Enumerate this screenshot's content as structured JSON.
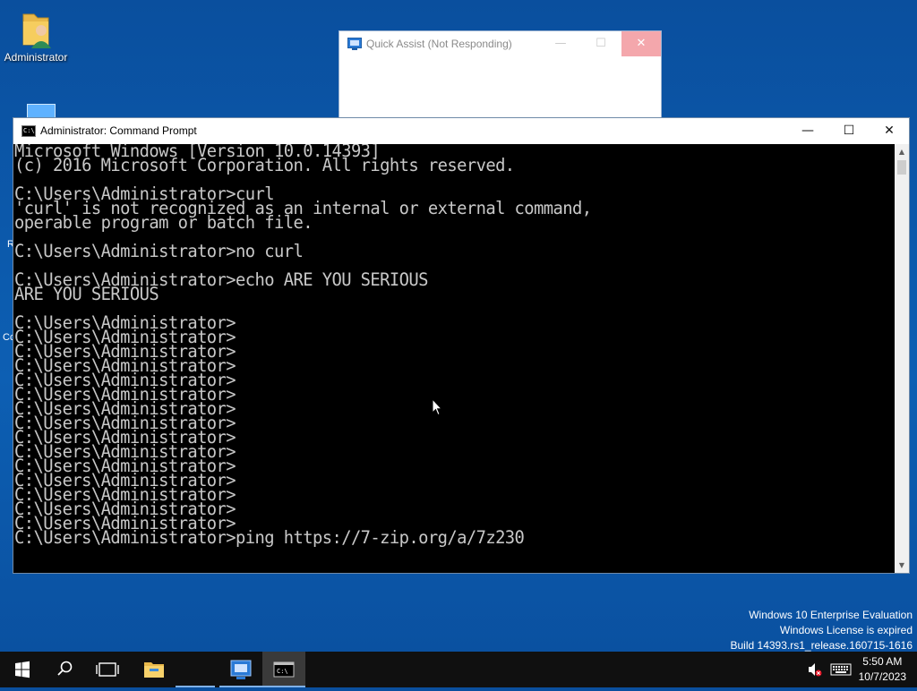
{
  "desktop": {
    "icons": [
      {
        "label": "Administrator"
      }
    ],
    "peek_letters": [
      "R",
      "Cc"
    ]
  },
  "quick_assist": {
    "title": "Quick Assist (Not Responding)",
    "minimize": "—",
    "maximize": "☐",
    "close": "✕"
  },
  "cmd": {
    "title": "Administrator: Command Prompt",
    "icon_text": "C:\\",
    "minimize": "—",
    "maximize": "☐",
    "close": "✕",
    "lines": [
      "Microsoft Windows [Version 10.0.14393]",
      "(c) 2016 Microsoft Corporation. All rights reserved.",
      "",
      "C:\\Users\\Administrator>curl",
      "'curl' is not recognized as an internal or external command,",
      "operable program or batch file.",
      "",
      "C:\\Users\\Administrator>no curl",
      "",
      "C:\\Users\\Administrator>echo ARE YOU SERIOUS",
      "ARE YOU SERIOUS",
      "",
      "C:\\Users\\Administrator>",
      "C:\\Users\\Administrator>",
      "C:\\Users\\Administrator>",
      "C:\\Users\\Administrator>",
      "C:\\Users\\Administrator>",
      "C:\\Users\\Administrator>",
      "C:\\Users\\Administrator>",
      "C:\\Users\\Administrator>",
      "C:\\Users\\Administrator>",
      "C:\\Users\\Administrator>",
      "C:\\Users\\Administrator>",
      "C:\\Users\\Administrator>",
      "C:\\Users\\Administrator>",
      "C:\\Users\\Administrator>",
      "C:\\Users\\Administrator>",
      "C:\\Users\\Administrator>ping https://7-zip.org/a/7z230"
    ]
  },
  "watermark": {
    "line1": "Windows 10 Enterprise Evaluation",
    "line2": "Windows License is expired",
    "line3": "Build 14393.rs1_release.160715-1616"
  },
  "taskbar": {
    "items": [
      {
        "name": "start-button",
        "icon": "windows-logo-icon"
      },
      {
        "name": "search-button",
        "icon": "search-icon"
      },
      {
        "name": "task-view-button",
        "icon": "task-view-icon"
      },
      {
        "name": "file-explorer",
        "icon": "folder-icon"
      },
      {
        "name": "quick-assist",
        "icon": "quick-assist-icon"
      },
      {
        "name": "command-prompt",
        "icon": "cmd-icon"
      }
    ],
    "clock": {
      "time": "5:50 AM",
      "date": "10/7/2023"
    },
    "colors": {
      "accent": "#7fb1e8",
      "background": "#101010"
    }
  }
}
